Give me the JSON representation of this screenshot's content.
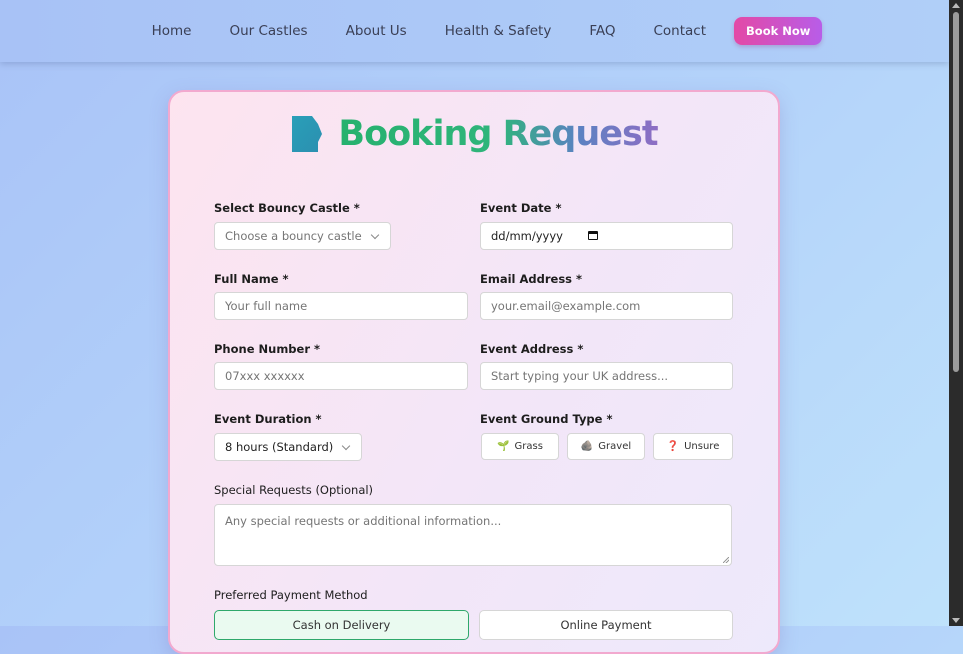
{
  "nav": {
    "links": [
      "Home",
      "Our Castles",
      "About Us",
      "Health & Safety",
      "FAQ",
      "Contact"
    ],
    "book_now": "Book Now"
  },
  "form": {
    "title": "Booking Request",
    "castle": {
      "label": "Select Bouncy Castle *",
      "value": "Choose a bouncy castle"
    },
    "event_date": {
      "label": "Event Date *",
      "value": "dd/mm/yyyy"
    },
    "full_name": {
      "label": "Full Name *",
      "placeholder": "Your full name"
    },
    "email": {
      "label": "Email Address *",
      "placeholder": "your.email@example.com"
    },
    "phone": {
      "label": "Phone Number *",
      "placeholder": "07xxx xxxxxx"
    },
    "address": {
      "label": "Event Address *",
      "placeholder": "Start typing your UK address..."
    },
    "duration": {
      "label": "Event Duration *",
      "value": "8 hours (Standard)"
    },
    "ground": {
      "label": "Event Ground Type *",
      "options": [
        {
          "icon": "🌱",
          "label": "Grass"
        },
        {
          "icon": "🪨",
          "label": "Gravel"
        },
        {
          "icon": "❓",
          "label": "Unsure"
        }
      ]
    },
    "special": {
      "label": "Special Requests (Optional)",
      "placeholder": "Any special requests or additional information..."
    },
    "payment": {
      "label": "Preferred Payment Method",
      "options": [
        "Cash on Delivery",
        "Online Payment"
      ]
    }
  },
  "colors": {
    "accent_pink": "#e349a6",
    "accent_purple": "#b85de8",
    "title_green": "#26b16e",
    "icon_teal": "#2a9fb8"
  }
}
